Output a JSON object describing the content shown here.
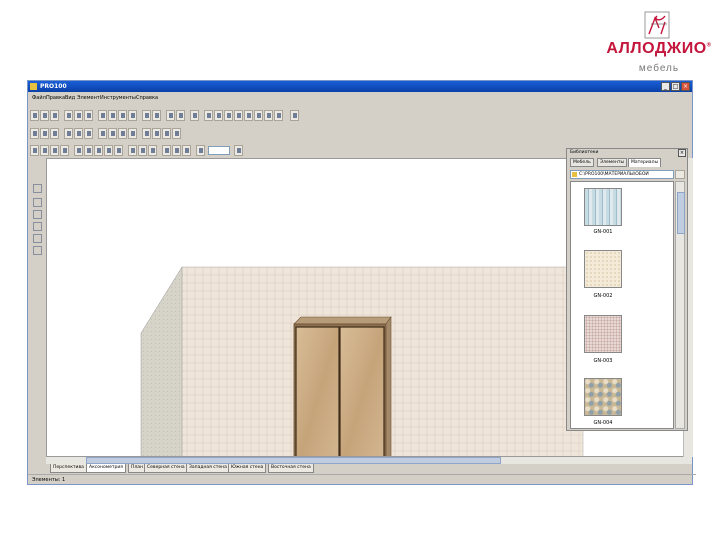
{
  "logo": {
    "name": "АЛЛОДЖИО",
    "sub": "мебель",
    "registered": "®"
  },
  "window": {
    "title": "PRO100",
    "buttons": {
      "minimize": "_",
      "maximize": "□",
      "close": "×"
    }
  },
  "menu": [
    "Файл",
    "Правка",
    "Вид",
    "Элемент",
    "Инструменты",
    "Справка"
  ],
  "zoom": {
    "value": ""
  },
  "colors": {
    "titlebar": "#0a3fa8",
    "wall": "#eee4d8",
    "side_wall": "#d7d4c8",
    "floor": "#f4ecec",
    "wardrobe_frame": "#6b4e2e",
    "wardrobe_door": "#cdb089",
    "logo_red": "#c4163c"
  },
  "view_tabs": [
    "Перспектива",
    "Аксонометрия",
    "План",
    "Северная стена",
    "Западная стена",
    "Южная стена",
    "Восточная стена"
  ],
  "active_tab": 1,
  "status": "Элементы: 1",
  "library": {
    "title": "Библиотеки",
    "tabs": [
      "Мебель",
      "Элементы",
      "Материалы"
    ],
    "active_tab": 2,
    "path": "C:\\PRO100\\МАТЕРИАЛЫ\\ОБОИ",
    "items": [
      {
        "label": "GN-001",
        "color": "#b9cfd8",
        "pattern": "stripes"
      },
      {
        "label": "GN-002",
        "color": "#f3ead7",
        "pattern": "dots"
      },
      {
        "label": "GN-003",
        "color": "#e8d8d4",
        "pattern": "speckle"
      },
      {
        "label": "GN-004",
        "color": "#c9b896",
        "pattern": "damask"
      }
    ]
  }
}
